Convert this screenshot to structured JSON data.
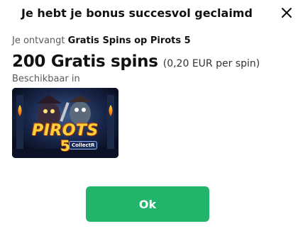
{
  "dialog": {
    "title": "Je hebt je bonus succesvol geclaimd",
    "close_icon": "close-icon"
  },
  "bonus": {
    "receive_prefix": "Je ontvangt",
    "bonus_name": "Gratis Spins op Pirots 5",
    "amount": "200 Gratis spins",
    "value_per_spin": "(0,20 EUR per spin)",
    "available_label": "Beschikbaar in"
  },
  "game": {
    "logo_text": "PIROTS",
    "logo_number": "5",
    "logo_badge": "CollectR"
  },
  "actions": {
    "ok_label": "Ok"
  },
  "colors": {
    "accent_button": "#22b46b",
    "text_primary": "#111111",
    "text_secondary": "#5a5a5a"
  }
}
